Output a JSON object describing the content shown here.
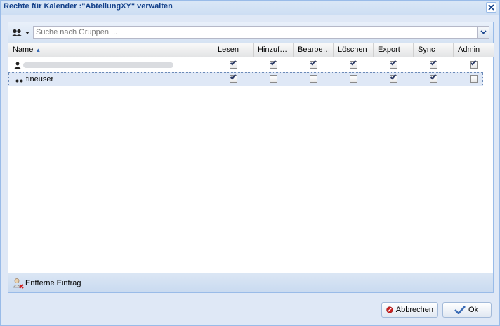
{
  "window": {
    "title": "Rechte für Kalender :\"AbteilungXY\" verwalten"
  },
  "toolbar": {
    "search_placeholder": "Suche nach Gruppen ..."
  },
  "grid": {
    "columns": {
      "name": "Name",
      "read": "Lesen",
      "add": "Hinzuf…",
      "edit": "Bearbe…",
      "delete": "Löschen",
      "export": "Export",
      "sync": "Sync",
      "admin": "Admin"
    },
    "rows": [
      {
        "name": "",
        "read": true,
        "add": true,
        "edit": true,
        "delete": true,
        "export": true,
        "sync": true,
        "admin": true
      },
      {
        "name": "tineuser",
        "read": true,
        "add": false,
        "edit": false,
        "delete": false,
        "export": true,
        "sync": true,
        "admin": false
      }
    ]
  },
  "footer": {
    "remove_label": "Entferne Eintrag"
  },
  "buttons": {
    "cancel_label": "Abbrechen",
    "ok_label": "Ok"
  },
  "colors": {
    "accent": "#15428b",
    "border": "#99bbe8",
    "selection": "#dfe8f6",
    "cancel_icon": "#cc2222",
    "ok_check": "#3a6bb5"
  }
}
